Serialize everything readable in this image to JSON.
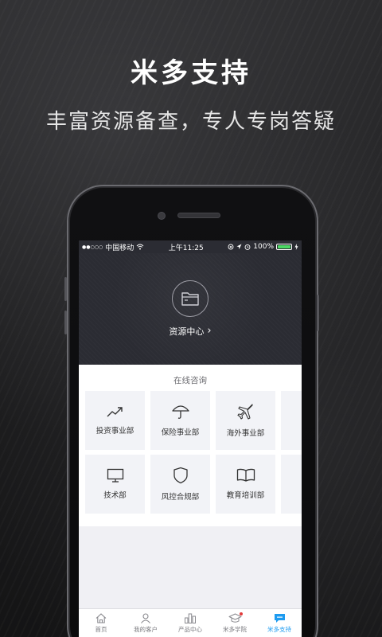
{
  "promo": {
    "title": "米多支持",
    "subtitle": "丰富资源备查，专人专岗答疑"
  },
  "status_bar": {
    "carrier": "中国移动",
    "signal": "●●○○○",
    "time": "上午11:25",
    "battery_percent": "100%",
    "battery_level": 1.0
  },
  "header": {
    "resource_center_label": "资源中心",
    "chevron": "›"
  },
  "consult": {
    "section_title": "在线咨询",
    "tiles": [
      {
        "label": "投资事业部",
        "icon": "trend-up-icon"
      },
      {
        "label": "保险事业部",
        "icon": "umbrella-icon"
      },
      {
        "label": "海外事业部",
        "icon": "airplane-icon"
      },
      {
        "label": "技术部",
        "icon": "monitor-icon"
      },
      {
        "label": "风控合规部",
        "icon": "shield-icon"
      },
      {
        "label": "教育培训部",
        "icon": "book-icon"
      }
    ]
  },
  "tabbar": {
    "tabs": [
      {
        "label": "首页",
        "icon": "home-icon"
      },
      {
        "label": "我的客户",
        "icon": "user-icon"
      },
      {
        "label": "产品中心",
        "icon": "bar-chart-icon"
      },
      {
        "label": "米多学院",
        "icon": "graduation-cap-icon"
      },
      {
        "label": "米多支持",
        "icon": "chat-icon"
      }
    ],
    "active_index": 4
  },
  "colors": {
    "header_bg": "#2b2c33",
    "tile_bg": "#f2f3f7",
    "accent": "#1d9bf0",
    "battery": "#4cd964"
  }
}
